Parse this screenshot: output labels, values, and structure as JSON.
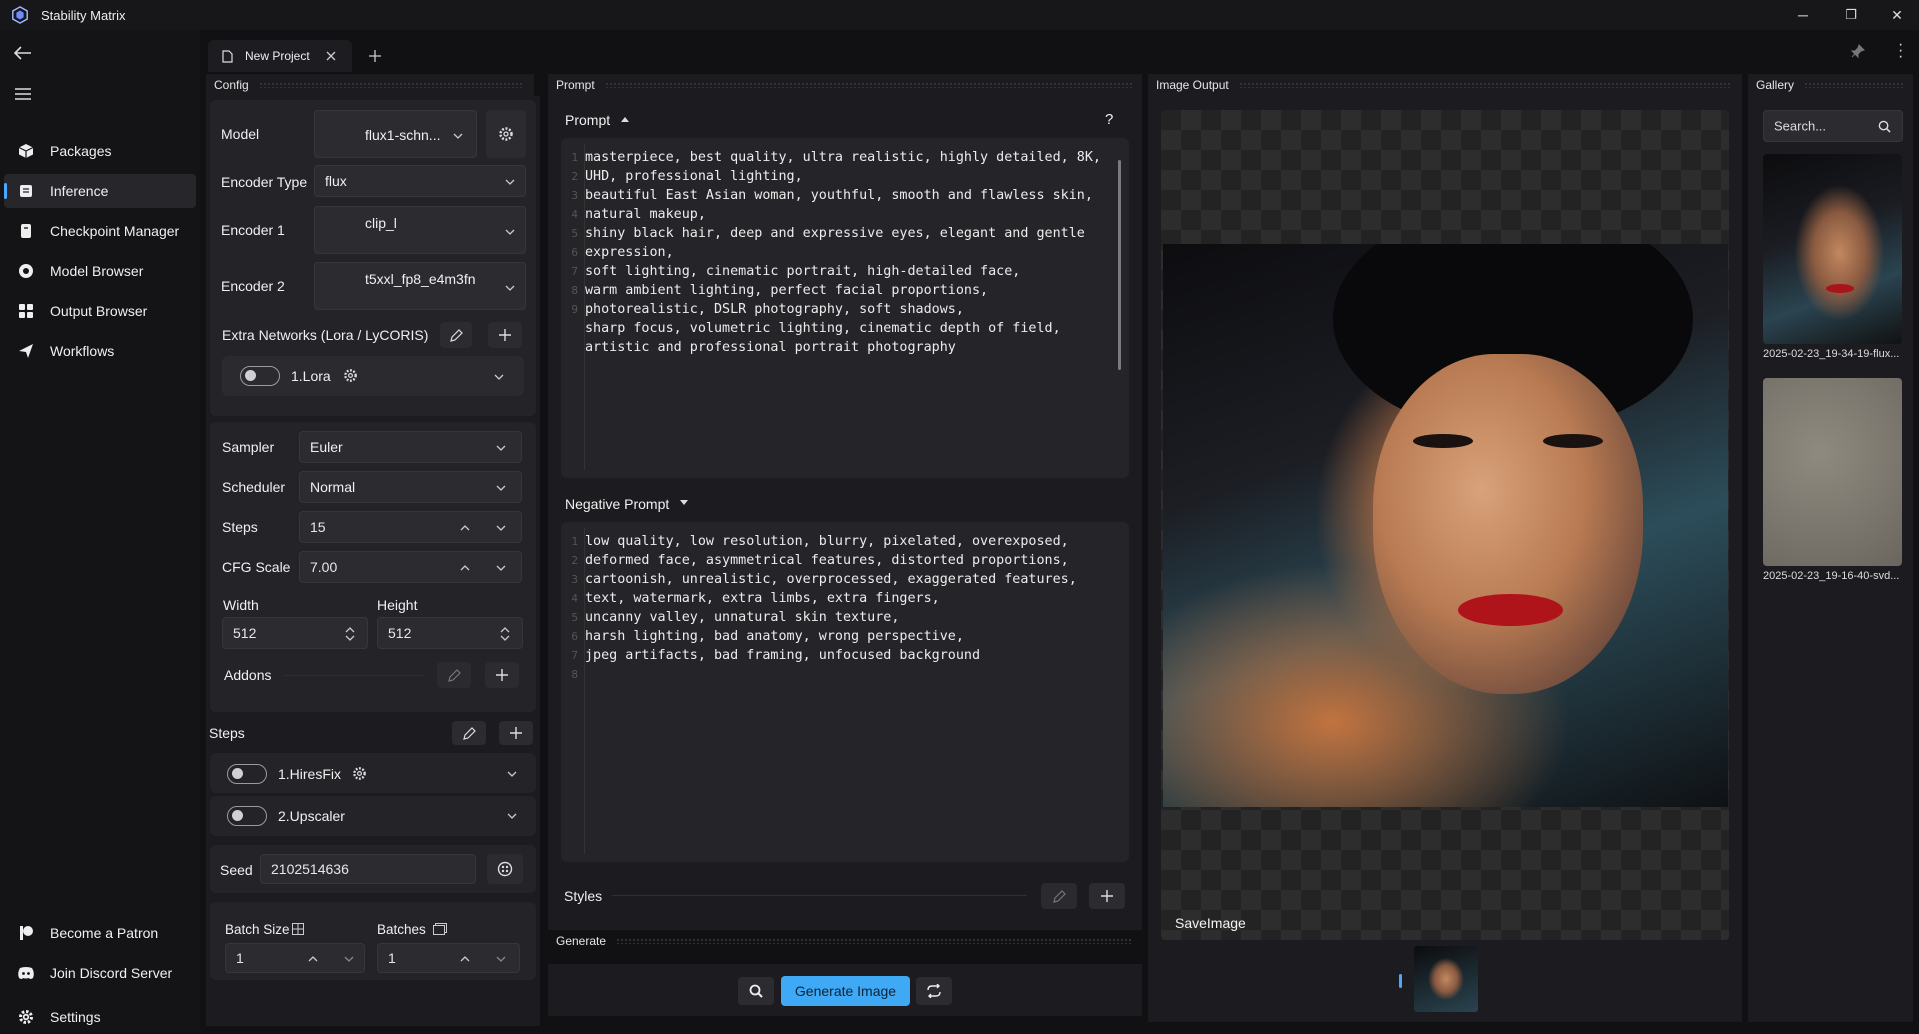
{
  "app": {
    "title": "Stability Matrix"
  },
  "window": {
    "minimize": "─",
    "restore": "❐",
    "close": "✕"
  },
  "sidebar": {
    "items": [
      {
        "label": "Packages",
        "icon": "package-icon"
      },
      {
        "label": "Inference",
        "icon": "inference-icon",
        "active": true
      },
      {
        "label": "Checkpoint Manager",
        "icon": "checkpoint-icon"
      },
      {
        "label": "Model Browser",
        "icon": "model-browser-icon"
      },
      {
        "label": "Output Browser",
        "icon": "output-browser-icon"
      },
      {
        "label": "Workflows",
        "icon": "workflows-icon"
      }
    ],
    "footer": [
      {
        "label": "Become a Patron",
        "icon": "patreon-icon"
      },
      {
        "label": "Join Discord Server",
        "icon": "discord-icon"
      },
      {
        "label": "Settings",
        "icon": "gear-icon"
      }
    ]
  },
  "tabs": {
    "active_label": "New Project"
  },
  "panels": {
    "config": "Config",
    "prompt": "Prompt",
    "image_output": "Image Output",
    "gallery": "Gallery",
    "generate": "Generate"
  },
  "config": {
    "model_label": "Model",
    "model_value": "flux1-schn...",
    "encoder_type_label": "Encoder Type",
    "encoder_type_value": "flux",
    "encoder1_label": "Encoder 1",
    "encoder1_value": "clip_l",
    "encoder2_label": "Encoder 2",
    "encoder2_value": "t5xxl_fp8_e4m3fn",
    "extra_networks_label": "Extra Networks (Lora / LyCORIS)",
    "lora_label": "1.Lora",
    "sampler_label": "Sampler",
    "sampler_value": "Euler",
    "scheduler_label": "Scheduler",
    "scheduler_value": "Normal",
    "steps_label": "Steps",
    "steps_value": "15",
    "cfg_label": "CFG Scale",
    "cfg_value": "7.00",
    "width_label": "Width",
    "width_value": "512",
    "height_label": "Height",
    "height_value": "512",
    "addons_label": "Addons",
    "steps_section_label": "Steps",
    "hiresfix_label": "1.HiresFix",
    "upscaler_label": "2.Upscaler",
    "seed_label": "Seed",
    "seed_value": "2102514636",
    "batch_size_label": "Batch Size",
    "batch_size_value": "1",
    "batches_label": "Batches",
    "batches_value": "1"
  },
  "prompt": {
    "prompt_header": "Prompt",
    "help": "?",
    "prompt_lines": [
      "masterpiece, best quality, ultra realistic, highly detailed, 8K,",
      "UHD, professional lighting,",
      "beautiful East Asian woman, youthful, smooth and flawless skin,",
      "natural makeup,",
      "shiny black hair, deep and expressive eyes, elegant and gentle",
      "expression,",
      "soft lighting, cinematic portrait, high-detailed face,",
      "warm ambient lighting, perfect facial proportions,",
      "photorealistic, DSLR photography, soft shadows,",
      "sharp focus, volumetric lighting, cinematic depth of field,",
      "artistic and professional portrait photography",
      ""
    ],
    "prompt_line_numbers": [
      "1",
      "",
      "2",
      "",
      "3",
      "",
      "4",
      "5",
      "6",
      "7",
      "8",
      "9"
    ],
    "negative_header": "Negative Prompt",
    "negative_lines": [
      "low quality, low resolution, blurry, pixelated, overexposed,",
      "deformed face, asymmetrical features, distorted proportions,",
      "cartoonish, unrealistic, overprocessed, exaggerated features,",
      "text, watermark, extra limbs, extra fingers,",
      "uncanny valley, unnatural skin texture,",
      "harsh lighting, bad anatomy, wrong perspective,",
      "jpeg artifacts, bad framing, unfocused background",
      ""
    ],
    "negative_line_numbers": [
      "1",
      "2",
      "3",
      "4",
      "5",
      "6",
      "7",
      "8"
    ],
    "styles_label": "Styles"
  },
  "generate": {
    "button_label": "Generate Image"
  },
  "output": {
    "save_label": "SaveImage"
  },
  "gallery": {
    "search_placeholder": "Search...",
    "items": [
      {
        "caption": "2025-02-23_19-34-19-flux..."
      },
      {
        "caption": "2025-02-23_19-16-40-svd..."
      }
    ]
  },
  "colors": {
    "accent": "#4aa8ff",
    "generate_button": "#3fa9f5"
  }
}
